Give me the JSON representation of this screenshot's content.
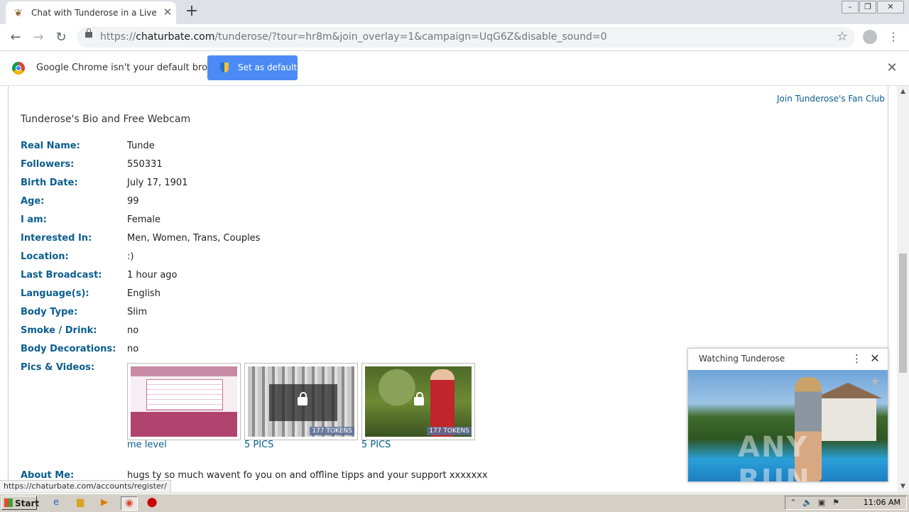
{
  "browser": {
    "tab_title": "Chat with Tunderose in a Live Adult",
    "url_prefix": "https://",
    "url_host": "chaturbate.com",
    "url_path": "/tunderose/?tour=hr8m&join_overlay=1&campaign=UqG6Z&disable_sound=0",
    "new_tab": "+"
  },
  "infobar": {
    "message": "Google Chrome isn't your default browser",
    "button_label": "Set as default",
    "close": "✕"
  },
  "page": {
    "fan_club": "Join Tunderose's Fan Club",
    "bio_title": "Tunderose's Bio and Free Webcam",
    "fields": [
      {
        "label": "Real Name:",
        "value": "Tunde"
      },
      {
        "label": "Followers:",
        "value": "550331"
      },
      {
        "label": "Birth Date:",
        "value": "July 17, 1901"
      },
      {
        "label": "Age:",
        "value": "99"
      },
      {
        "label": "I am:",
        "value": "Female"
      },
      {
        "label": "Interested In:",
        "value": "Men, Women, Trans, Couples"
      },
      {
        "label": "Location:",
        "value": ":)"
      },
      {
        "label": "Last Broadcast:",
        "value": "1 hour ago"
      },
      {
        "label": "Language(s):",
        "value": "English"
      },
      {
        "label": "Body Type:",
        "value": "Slim"
      },
      {
        "label": "Smoke / Drink:",
        "value": "no"
      },
      {
        "label": "Body Decorations:",
        "value": "no"
      }
    ],
    "pics_label": "Pics & Videos:",
    "thumbnails": [
      {
        "caption": "me level",
        "tokens": ""
      },
      {
        "caption": "5 PICS",
        "tokens": "177 TOKENS"
      },
      {
        "caption": "5 PICS",
        "tokens": "177 TOKENS"
      }
    ],
    "about_label": "About Me:",
    "about_value": "hugs ty so much wavent fo you on and offline tipps and your support xxxxxxx"
  },
  "floating_player": {
    "title": "Watching Tunderose",
    "watermark": "ANY RUN"
  },
  "status_url": "https://chaturbate.com/accounts/register/",
  "taskbar": {
    "start_label": "Start",
    "clock": "11:06 AM"
  }
}
